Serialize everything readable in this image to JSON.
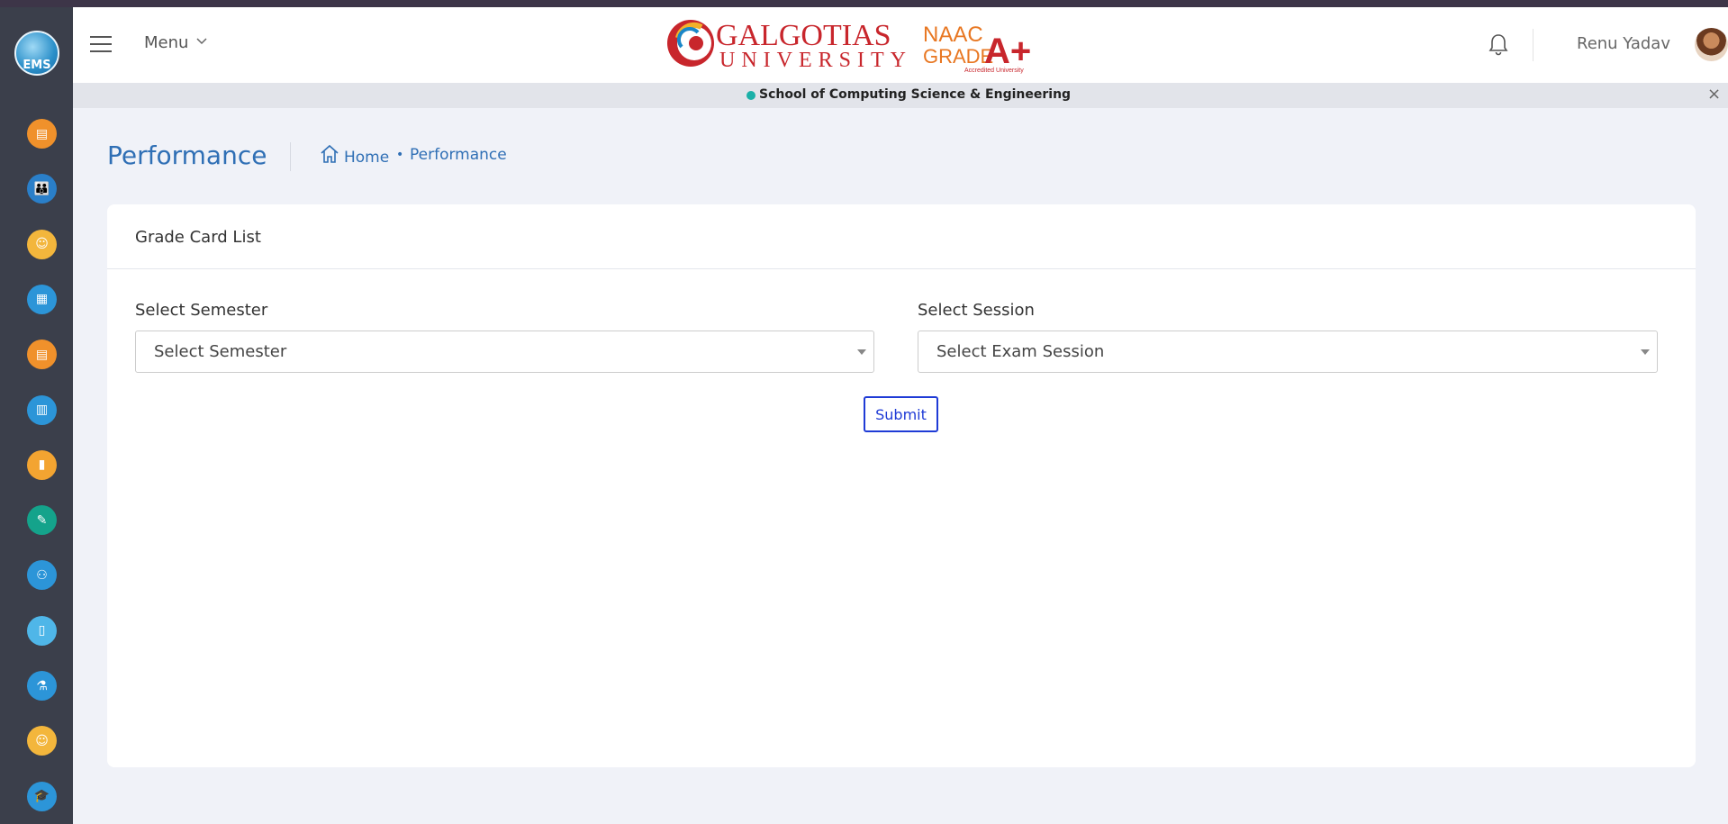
{
  "header": {
    "menu_label": "Menu",
    "brand_word1": "GALGOTIAS",
    "brand_word2": "UNIVERSITY",
    "naac_line1": "NAAC",
    "naac_line2": "GRADE",
    "naac_grade": "A+",
    "naac_tagline": "Accredited University",
    "user_name": "Renu Yadav"
  },
  "sidebar": {
    "logo_text": "EMS",
    "items": [
      {
        "icon": "notes-icon",
        "color": "#f0912b"
      },
      {
        "icon": "people-icon",
        "color": "#2a7fc9"
      },
      {
        "icon": "teacher-icon",
        "color": "#f3b63c"
      },
      {
        "icon": "classroom-icon",
        "color": "#2c95d8"
      },
      {
        "icon": "clipboard-icon",
        "color": "#f0912b"
      },
      {
        "icon": "building-icon",
        "color": "#2c95d8"
      },
      {
        "icon": "books-icon",
        "color": "#f3a431"
      },
      {
        "icon": "exam-icon",
        "color": "#14a38b"
      },
      {
        "icon": "group-icon",
        "color": "#2c95d8"
      },
      {
        "icon": "document-icon",
        "color": "#4fb6e8"
      },
      {
        "icon": "lab-icon",
        "color": "#2c95d8"
      },
      {
        "icon": "student-icon",
        "color": "#f3b63c"
      },
      {
        "icon": "graduation-icon",
        "color": "#2c95d8"
      }
    ]
  },
  "school_bar": {
    "name": "School of Computing Science & Engineering",
    "close": "×"
  },
  "page": {
    "title": "Performance",
    "breadcrumb_home": "Home",
    "breadcrumb_sep": "•",
    "breadcrumb_current": "Performance"
  },
  "card": {
    "title": "Grade Card List",
    "semester_label": "Select Semester",
    "semester_value": "Select Semester",
    "session_label": "Select Session",
    "session_value": "Select Exam Session",
    "submit_label": "Submit"
  }
}
